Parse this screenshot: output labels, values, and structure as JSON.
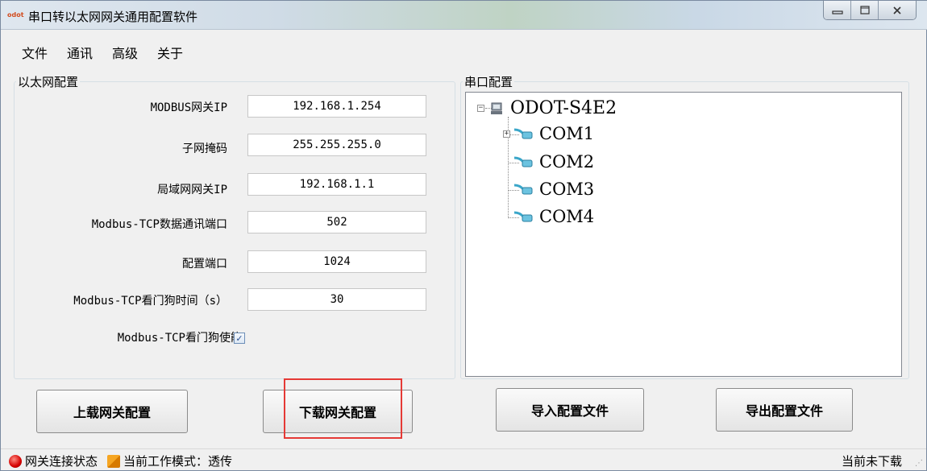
{
  "window": {
    "title": "串口转以太网网关通用配置软件",
    "icon_text": "odot",
    "controls": [
      "minimize",
      "maximize",
      "close"
    ]
  },
  "menu": [
    "文件",
    "通讯",
    "高级",
    "关于"
  ],
  "ethernet": {
    "group_title": "以太网配置",
    "fields": [
      {
        "label": "MODBUS网关IP",
        "value": "192.168.1.254"
      },
      {
        "label": "子网掩码",
        "value": "255.255.255.0"
      },
      {
        "label": "局域网网关IP",
        "value": "192.168.1.1"
      },
      {
        "label": "Modbus-TCP数据通讯端口",
        "value": "502"
      },
      {
        "label": "配置端口",
        "value": "1024"
      },
      {
        "label": "Modbus-TCP看门狗时间（s）",
        "value": "30"
      }
    ],
    "watchdog_enable": {
      "label": "Modbus-TCP看门狗使能",
      "checked": true,
      "check_glyph": "✓"
    }
  },
  "serial": {
    "group_title": "串口配置",
    "root": {
      "label": "ODOT-S4E2",
      "expander": "−"
    },
    "ports": [
      {
        "label": "COM1",
        "expander": "+"
      },
      {
        "label": "COM2"
      },
      {
        "label": "COM3"
      },
      {
        "label": "COM4"
      }
    ]
  },
  "buttons": {
    "upload": "上载网关配置",
    "download": "下载网关配置",
    "import": "导入配置文件",
    "export": "导出配置文件"
  },
  "status": {
    "connection": "网关连接状态",
    "mode": "当前工作模式：透传",
    "download_state": "当前未下载"
  },
  "colors": {
    "highlight": "#e53935",
    "status_dot": "#d50000"
  }
}
